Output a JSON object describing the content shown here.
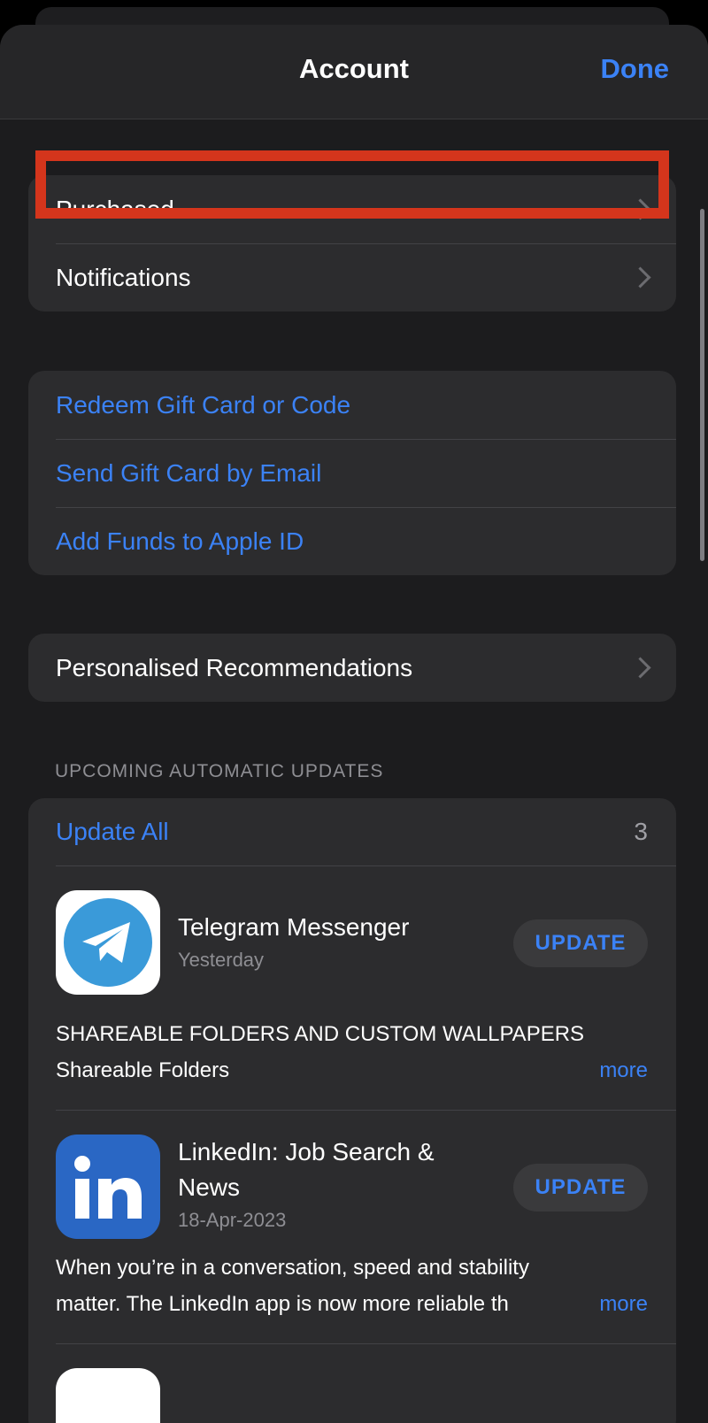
{
  "header": {
    "title": "Account",
    "done_label": "Done"
  },
  "group_account": [
    {
      "label": "Purchased",
      "highlighted": true
    },
    {
      "label": "Notifications"
    }
  ],
  "group_gift": [
    {
      "label": "Redeem Gift Card or Code"
    },
    {
      "label": "Send Gift Card by Email"
    },
    {
      "label": "Add Funds to Apple ID"
    }
  ],
  "personalised": {
    "label": "Personalised Recommendations"
  },
  "updates": {
    "section_title": "UPCOMING AUTOMATIC UPDATES",
    "update_all_label": "Update All",
    "count": "3",
    "apps": [
      {
        "name": "Telegram Messenger",
        "date": "Yesterday",
        "button": "UPDATE",
        "notes_line1": "SHAREABLE FOLDERS AND CUSTOM WALLPAPERS",
        "notes_line2": "Shareable Folders",
        "more": "more",
        "icon": "telegram-icon"
      },
      {
        "name": "LinkedIn: Job Search & News",
        "date": "18-Apr-2023",
        "button": "UPDATE",
        "notes_line1": "When you’re in a conversation, speed and stability",
        "notes_line2": "matter. The LinkedIn app is now more reliable th",
        "more": "more",
        "icon": "linkedin-icon"
      }
    ]
  },
  "colors": {
    "accent": "#3b82f6",
    "highlight_border": "#d4351c"
  }
}
